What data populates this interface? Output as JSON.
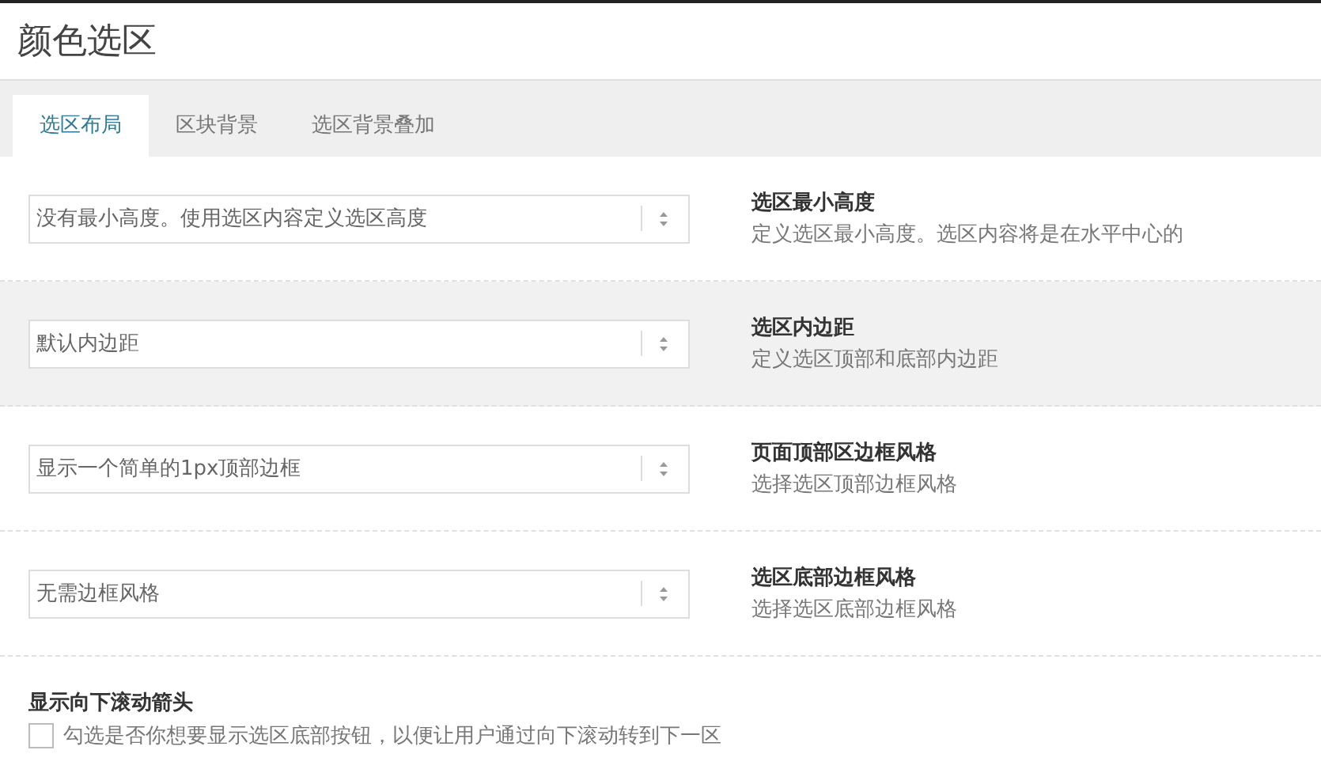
{
  "window": {
    "title": "颜色选区"
  },
  "tabs": [
    {
      "label": "选区布局",
      "selected": true
    },
    {
      "label": "区块背景",
      "selected": false
    },
    {
      "label": "选区背景叠加",
      "selected": false
    }
  ],
  "settings": [
    {
      "value": "没有最小高度。使用选区内容定义选区高度",
      "label": "选区最小高度",
      "description": "定义选区最小高度。选区内容将是在水平中心的",
      "highlighted": false
    },
    {
      "value": "默认内边距",
      "label": "选区内边距",
      "description": "定义选区顶部和底部内边距",
      "highlighted": true
    },
    {
      "value": "显示一个简单的1px顶部边框",
      "label": "页面顶部区边框风格",
      "description": "选择选区顶部边框风格",
      "highlighted": false
    },
    {
      "value": "无需边框风格",
      "label": "选区底部边框风格",
      "description": "选择选区底部边框风格",
      "highlighted": false
    }
  ],
  "scroll_arrow": {
    "label": "显示向下滚动箭头",
    "description": "勾选是否你想要显示选区底部按钮，以便让用户通过向下滚动转到下一区",
    "checked": false
  }
}
